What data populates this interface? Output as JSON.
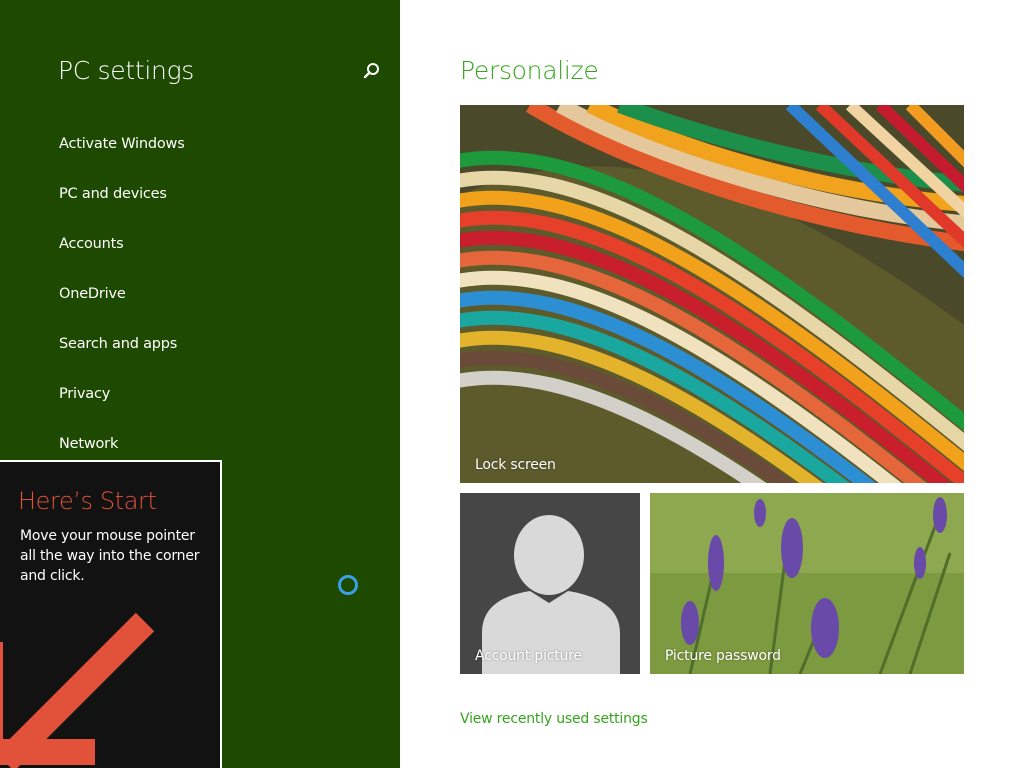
{
  "sidebar": {
    "title": "PC settings",
    "search_icon": "search-icon",
    "items": [
      {
        "label": "Activate Windows"
      },
      {
        "label": "PC and devices"
      },
      {
        "label": "Accounts"
      },
      {
        "label": "OneDrive"
      },
      {
        "label": "Search and apps"
      },
      {
        "label": "Privacy"
      },
      {
        "label": "Network"
      }
    ]
  },
  "start_tip": {
    "title": "Here’s Start",
    "body": "Move your mouse pointer all the way into the corner and click.",
    "arrow_icon": "arrow-down-left-icon"
  },
  "main": {
    "title": "Personalize",
    "tiles": {
      "lock_screen": {
        "label": "Lock screen"
      },
      "account_picture": {
        "label": "Account picture"
      },
      "picture_password": {
        "label": "Picture password"
      }
    },
    "recent_link": "View recently used settings"
  },
  "colors": {
    "sidebar_bg": "#1e4900",
    "accent_green": "#35a51d",
    "tip_title": "#e2513a",
    "tip_bg": "#121212",
    "busy_ring": "#3aa0e8"
  }
}
